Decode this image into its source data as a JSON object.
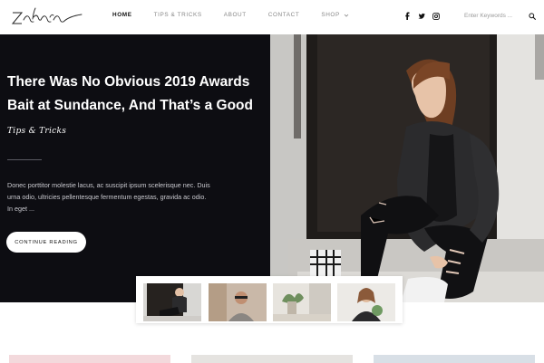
{
  "brand": {
    "logo_text": "zahara"
  },
  "nav": {
    "items": [
      {
        "label": "HOME",
        "active": true
      },
      {
        "label": "TIPS & TRICKS",
        "active": false
      },
      {
        "label": "ABOUT",
        "active": false
      },
      {
        "label": "CONTACT",
        "active": false
      },
      {
        "label": "SHOP",
        "active": false,
        "has_dropdown": true
      }
    ]
  },
  "social": {
    "icons": [
      "facebook-icon",
      "twitter-icon",
      "instagram-icon"
    ]
  },
  "search": {
    "placeholder": "Enter Keywords ..."
  },
  "hero": {
    "title": "There Was No Obvious 2019 Awards Bait at Sundance, And That’s a Good",
    "category": "Tips & Tricks",
    "excerpt": "Donec porttitor molestie lacus, ac suscipit ipsum scelerisque nec. Duis urna odio, ultricies pellentesque fermentum egestas, gravida ac odio. In eget ...",
    "button_label": "CONTINUE READING"
  },
  "colors": {
    "hero_dark": "#0d0d12",
    "accent": "#ffffff",
    "nav_active": "#111111",
    "nav_inactive": "#888888"
  }
}
